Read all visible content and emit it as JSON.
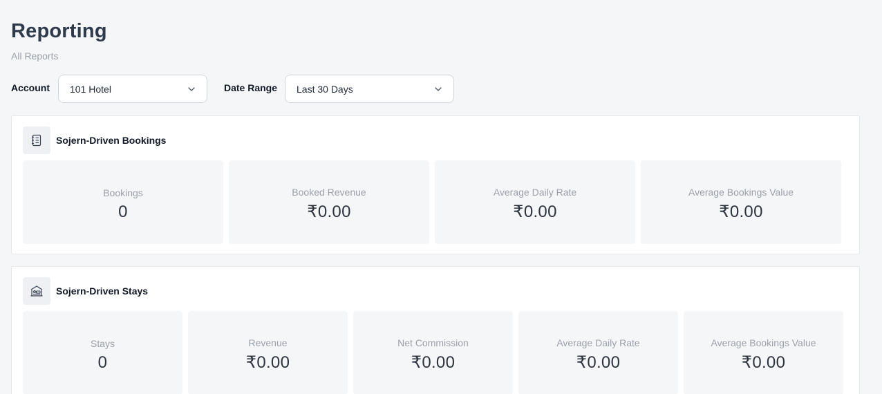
{
  "page": {
    "title": "Reporting",
    "subtitle": "All Reports"
  },
  "filters": {
    "account_label": "Account",
    "account_value": "101 Hotel",
    "date_range_label": "Date Range",
    "date_range_value": "Last 30 Days"
  },
  "bookings": {
    "title": "Sojern-Driven Bookings",
    "icon": "list-document-icon",
    "metrics": [
      {
        "label": "Bookings",
        "value": "0"
      },
      {
        "label": "Booked Revenue",
        "value": "₹0.00"
      },
      {
        "label": "Average Daily Rate",
        "value": "₹0.00"
      },
      {
        "label": "Average Bookings Value",
        "value": "₹0.00"
      }
    ]
  },
  "stays": {
    "title": "Sojern-Driven Stays",
    "icon": "bed-icon",
    "metrics": [
      {
        "label": "Stays",
        "value": "0"
      },
      {
        "label": "Revenue",
        "value": "₹0.00"
      },
      {
        "label": "Net Commission",
        "value": "₹0.00"
      },
      {
        "label": "Average Daily Rate",
        "value": "₹0.00"
      },
      {
        "label": "Average Bookings Value",
        "value": "₹0.00"
      }
    ]
  }
}
